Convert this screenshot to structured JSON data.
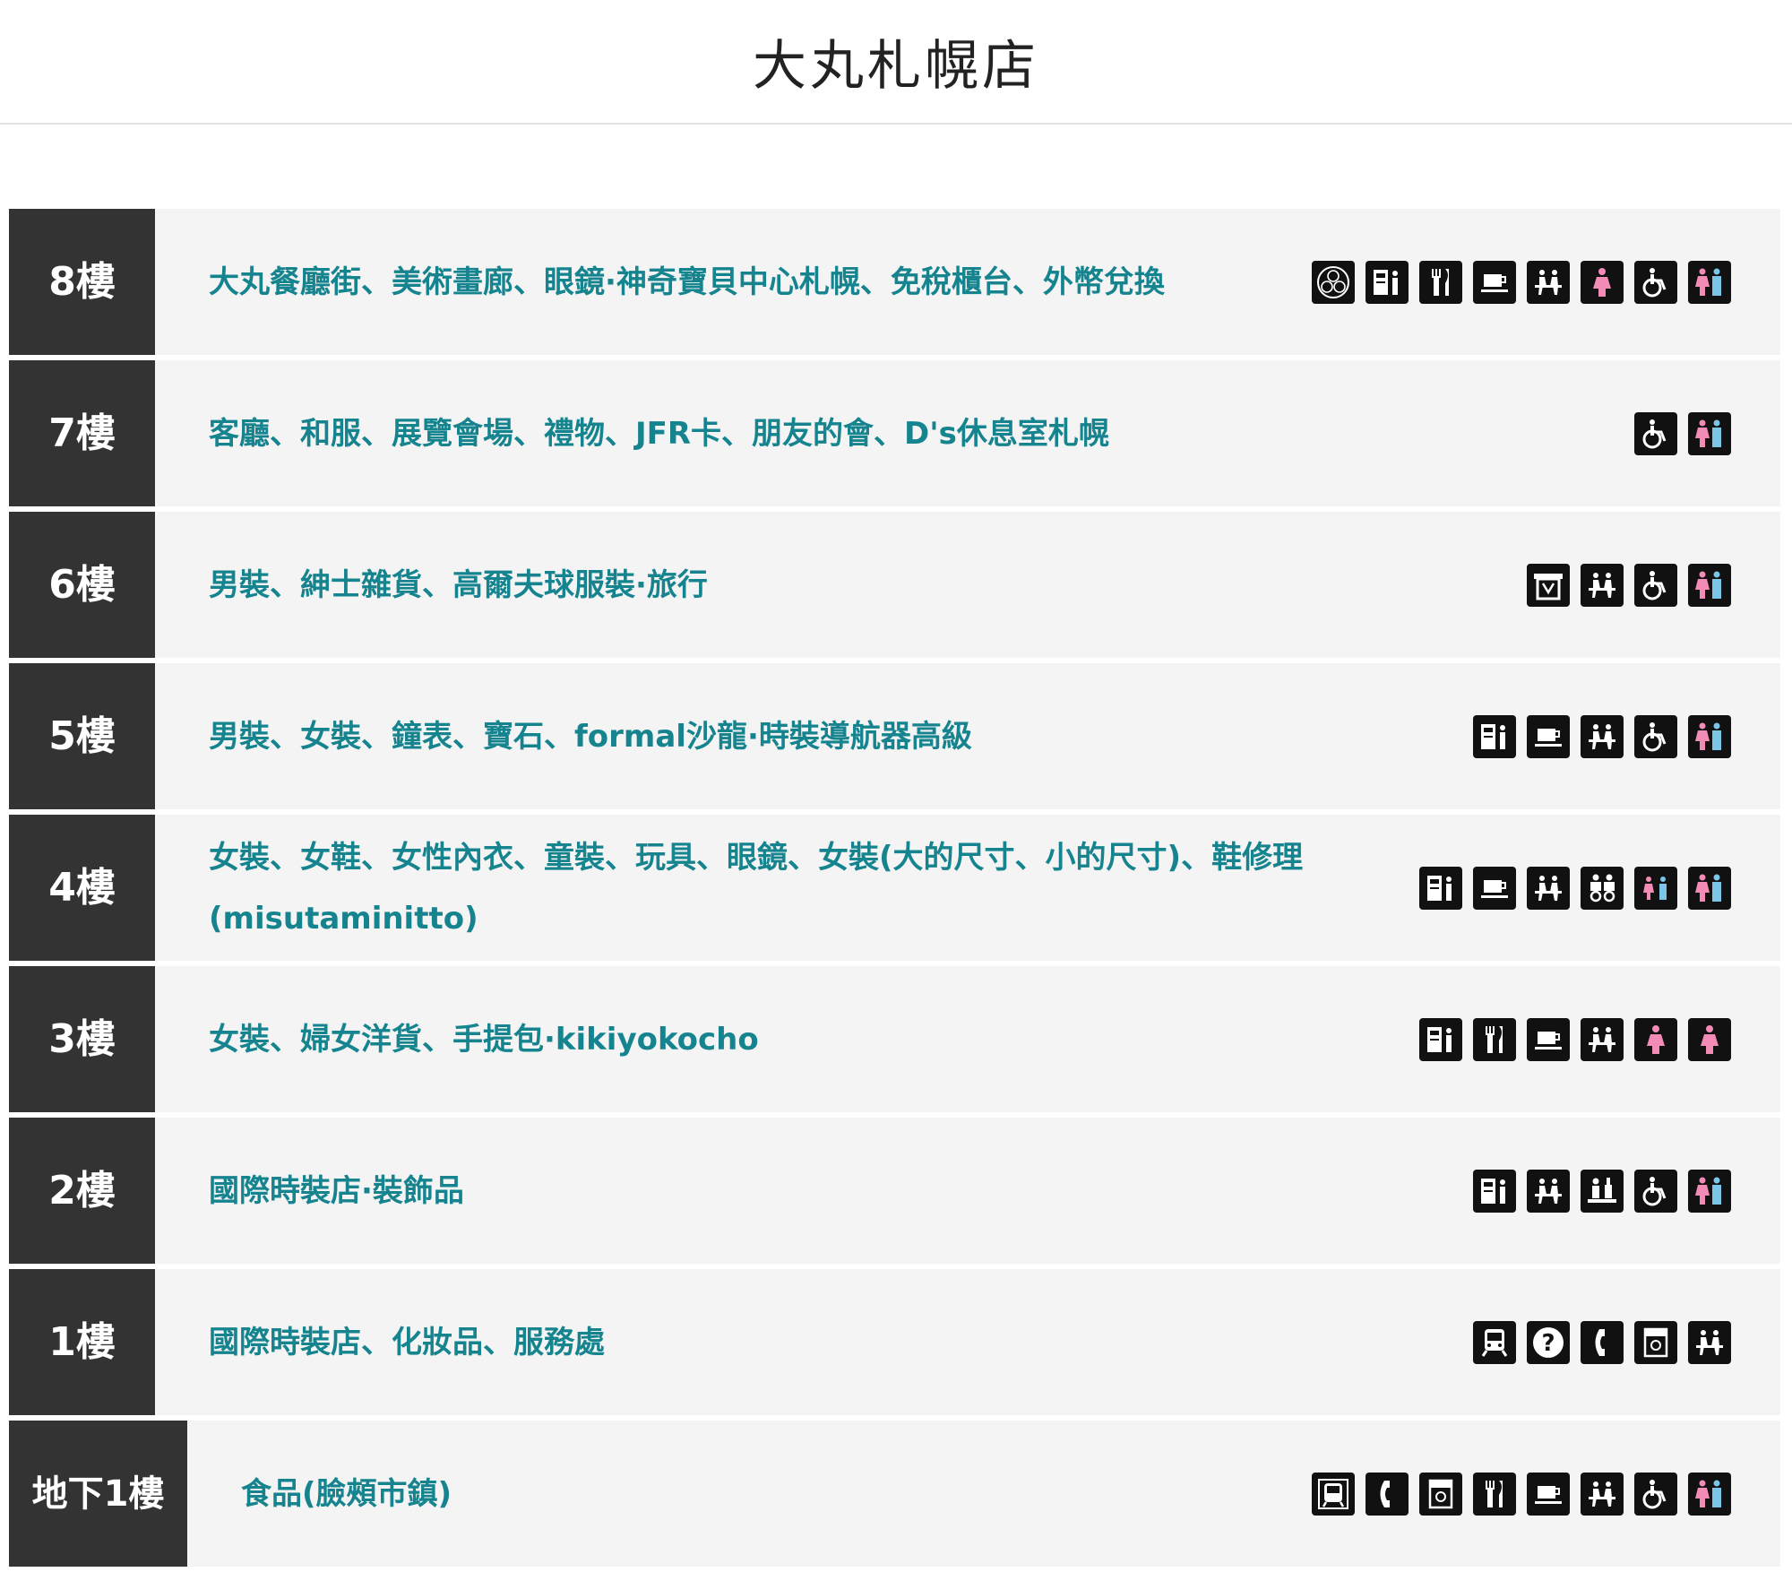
{
  "header": {
    "title": "大丸札幌店"
  },
  "floors": [
    {
      "label": "8樓",
      "description": "大丸餐廳街、美術畫廊、眼鏡·神奇寶貝中心札幌、免稅櫃台、外幣兌換",
      "icons": [
        "tax-free-icon",
        "atm-icon",
        "restaurant-icon",
        "cafe-icon",
        "rest-area-icon",
        "womens-restroom-icon",
        "accessible-restroom-icon",
        "restroom-icon"
      ]
    },
    {
      "label": "7樓",
      "description": "客廳、和服、展覽會場、禮物、JFR卡、朋友的會、D's休息室札幌",
      "icons": [
        "accessible-restroom-icon",
        "restroom-icon"
      ]
    },
    {
      "label": "6樓",
      "description": "男裝、紳士雜貨、高爾夫球服裝·旅行",
      "icons": [
        "tax-refund-icon",
        "rest-area-icon",
        "accessible-restroom-icon",
        "restroom-icon"
      ]
    },
    {
      "label": "5樓",
      "description": "男裝、女裝、鐘表、寶石、formal沙龍·時裝導航器高級",
      "icons": [
        "atm-icon",
        "cafe-icon",
        "rest-area-icon",
        "accessible-restroom-icon",
        "restroom-icon"
      ]
    },
    {
      "label": "4樓",
      "description": "女裝、女鞋、女性內衣、童裝、玩具、眼鏡、女裝(大的尺寸、小的尺寸)、鞋修理(misutaminitto)",
      "icons": [
        "atm-icon",
        "cafe-icon",
        "rest-area-icon",
        "baby-room-icon",
        "kids-restroom-icon",
        "restroom-icon"
      ]
    },
    {
      "label": "3樓",
      "description": "女裝、婦女洋貨、手提包·kikiyokocho",
      "icons": [
        "atm-icon",
        "restaurant-icon",
        "cafe-icon",
        "rest-area-icon",
        "womens-restroom-icon",
        "womens-icon"
      ]
    },
    {
      "label": "2樓",
      "description": "國際時裝店·裝飾品",
      "icons": [
        "atm-icon",
        "rest-area-icon",
        "nursing-room-icon",
        "accessible-restroom-icon",
        "restroom-icon"
      ]
    },
    {
      "label": "1樓",
      "description": "國際時裝店、化妝品、服務處",
      "icons": [
        "train-icon",
        "information-icon",
        "phone-icon",
        "locker-icon",
        "rest-area-icon"
      ]
    },
    {
      "label": "地下1樓",
      "description": "食品(臉頰市鎮)",
      "icons": [
        "subway-icon",
        "phone-icon",
        "locker-icon",
        "restaurant-icon",
        "cafe-icon",
        "rest-area-icon",
        "accessible-restroom-icon",
        "restroom-icon"
      ]
    }
  ],
  "colors": {
    "accent": "#16848f",
    "floor_label_bg": "#333333",
    "row_bg": "#f4f4f4",
    "pink": "#f28cb6",
    "blue": "#7ac5e8"
  }
}
